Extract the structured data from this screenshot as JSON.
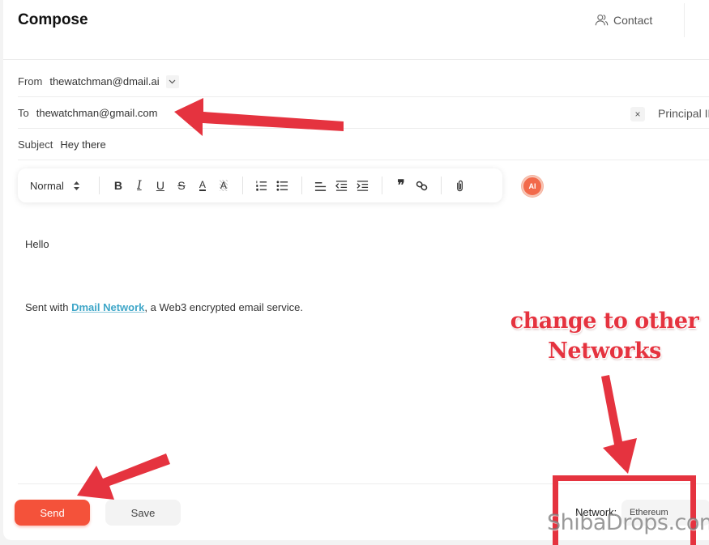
{
  "header": {
    "title": "Compose",
    "contact_label": "Contact",
    "contact_icon": "users-icon"
  },
  "fields": {
    "from": {
      "label": "From",
      "value": "thewatchman@dmail.ai",
      "dropdown_icon": "chevron-down-icon"
    },
    "to": {
      "label": "To",
      "value": "thewatchman@gmail.com",
      "clear_icon": "close-icon",
      "clear_glyph": "×",
      "principal_id_label": "Principal ID"
    },
    "subject": {
      "label": "Subject",
      "value": "Hey there"
    }
  },
  "toolbar": {
    "text_style": "Normal",
    "buttons": [
      {
        "name": "bold",
        "icon": "bold-icon",
        "glyph": "B"
      },
      {
        "name": "italic",
        "icon": "italic-icon",
        "glyph": "I"
      },
      {
        "name": "underline",
        "icon": "underline-icon",
        "glyph": "U"
      },
      {
        "name": "strikethrough",
        "icon": "strikethrough-icon",
        "glyph": "S"
      },
      {
        "name": "text-color",
        "icon": "text-color-icon",
        "glyph": "A"
      },
      {
        "name": "highlight",
        "icon": "highlight-icon",
        "glyph": "A"
      },
      {
        "name": "ordered-list",
        "icon": "ordered-list-icon"
      },
      {
        "name": "bullet-list",
        "icon": "bullet-list-icon"
      },
      {
        "name": "align",
        "icon": "align-icon"
      },
      {
        "name": "outdent",
        "icon": "outdent-icon"
      },
      {
        "name": "indent",
        "icon": "indent-icon"
      },
      {
        "name": "blockquote",
        "icon": "quote-icon",
        "glyph": "❞"
      },
      {
        "name": "link",
        "icon": "link-icon"
      },
      {
        "name": "attach",
        "icon": "paperclip-icon"
      }
    ],
    "ai_label": "AI"
  },
  "body": {
    "greeting": "Hello",
    "signature_prefix": "Sent with ",
    "signature_link": "Dmail Network",
    "signature_suffix": ", a Web3 encrypted email service."
  },
  "footer": {
    "send_label": "Send",
    "save_label": "Save",
    "network_label": "Network:",
    "network_value": "Ethereum"
  },
  "annotations": {
    "callout_line1": "change to other",
    "callout_line2": "Networks",
    "accent_color": "#e5333f",
    "watermark": "ShibaDrops.com"
  },
  "colors": {
    "send_button": "#f4523a",
    "link": "#3ea6c8",
    "ai_badge": "#f26a4b"
  }
}
